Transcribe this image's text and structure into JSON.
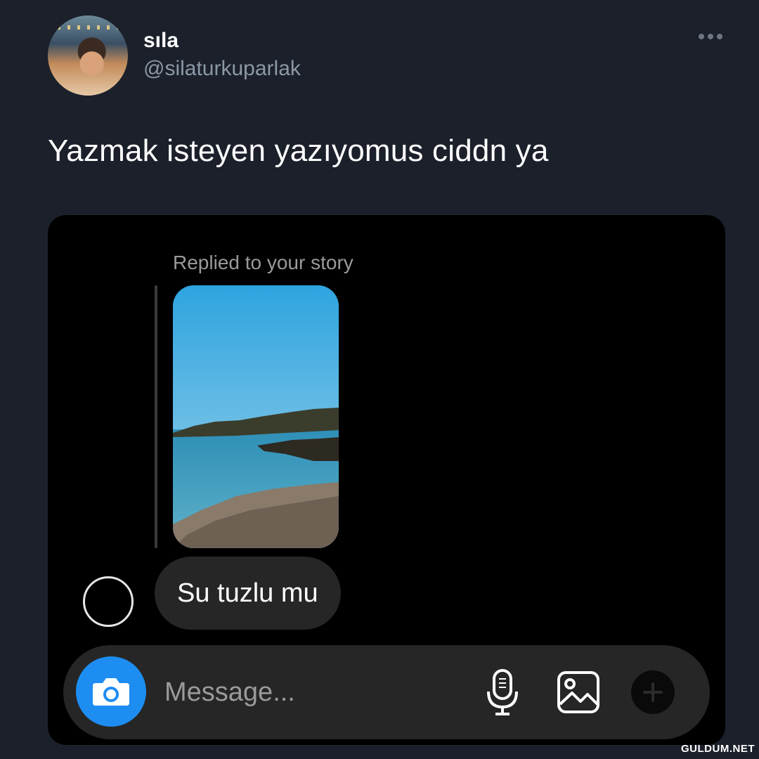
{
  "tweet": {
    "display_name": "sıla",
    "handle": "@silaturkuparlak",
    "text": "Yazmak isteyen yazıyomus ciddn ya"
  },
  "dm": {
    "replied_label": "Replied to your story",
    "message": "Su tuzlu mu",
    "composer_placeholder": "Message..."
  },
  "watermark": "GULDUM.NET",
  "colors": {
    "background": "#1b202b",
    "media_background": "#000000",
    "bubble": "#262626",
    "camera_button": "#1d8df2",
    "handle_text": "#8b98a5"
  },
  "icons": [
    "more-icon",
    "camera-icon",
    "mic-icon",
    "gallery-icon",
    "plus-icon"
  ]
}
